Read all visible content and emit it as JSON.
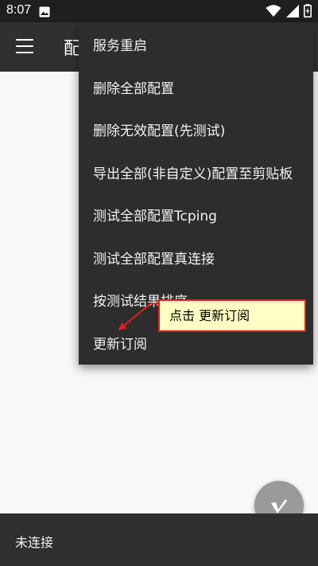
{
  "status_bar": {
    "time": "8:07",
    "icons": [
      "image-icon",
      "wifi-icon",
      "signal-icon",
      "battery-icon"
    ]
  },
  "toolbar": {
    "title": "配置文件"
  },
  "overflow_menu": {
    "items": [
      "服务重启",
      "删除全部配置",
      "删除无效配置(先测试)",
      "导出全部(非自定义)配置至剪贴板",
      "测试全部配置Tcping",
      "测试全部配置真连接",
      "按测试结果排序",
      "更新订阅"
    ]
  },
  "callout": {
    "text": "点击 更新订阅"
  },
  "bottom_bar": {
    "status": "未连接"
  },
  "colors": {
    "status_bar": "#1f1f1f",
    "toolbar": "#303030",
    "menu": "#2d2d2d",
    "callout_bg": "#ffffc4",
    "callout_border": "#e61d1d",
    "fab": "#9a9a9a",
    "bottom_bar": "#2f2f2f"
  }
}
